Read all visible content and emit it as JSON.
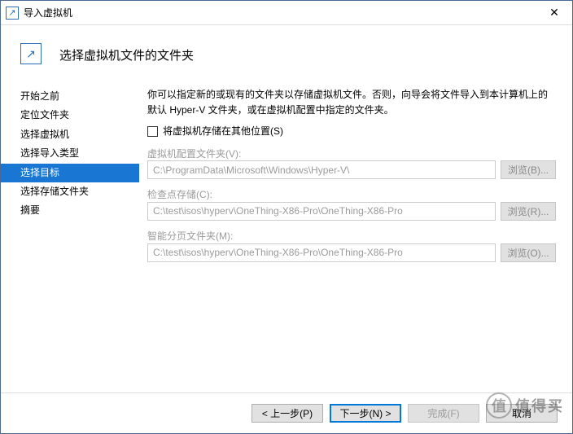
{
  "window": {
    "title": "导入虚拟机",
    "close_glyph": "✕"
  },
  "header": {
    "icon_glyph": "↗",
    "title": "选择虚拟机文件的文件夹"
  },
  "sidebar": {
    "items": [
      {
        "label": "开始之前"
      },
      {
        "label": "定位文件夹"
      },
      {
        "label": "选择虚拟机"
      },
      {
        "label": "选择导入类型"
      },
      {
        "label": "选择目标"
      },
      {
        "label": "选择存储文件夹"
      },
      {
        "label": "摘要"
      }
    ],
    "selected_index": 4
  },
  "content": {
    "description": "你可以指定新的或现有的文件夹以存储虚拟机文件。否则，向导会将文件导入到本计算机上的默认 Hyper-V 文件夹，或在虚拟机配置中指定的文件夹。",
    "checkbox_label": "将虚拟机存储在其他位置(S)",
    "checkbox_checked": false,
    "fields": [
      {
        "label": "虚拟机配置文件夹(V):",
        "value": "C:\\ProgramData\\Microsoft\\Windows\\Hyper-V\\",
        "browse": "浏览(B)..."
      },
      {
        "label": "检查点存储(C):",
        "value": "C:\\test\\isos\\hyperv\\OneThing-X86-Pro\\OneThing-X86-Pro",
        "browse": "浏览(R)..."
      },
      {
        "label": "智能分页文件夹(M):",
        "value": "C:\\test\\isos\\hyperv\\OneThing-X86-Pro\\OneThing-X86-Pro",
        "browse": "浏览(O)..."
      }
    ]
  },
  "footer": {
    "prev": "< 上一步(P)",
    "next": "下一步(N) >",
    "finish": "完成(F)",
    "cancel": "取消"
  },
  "watermark": {
    "glyph": "值",
    "text": "值得买"
  }
}
